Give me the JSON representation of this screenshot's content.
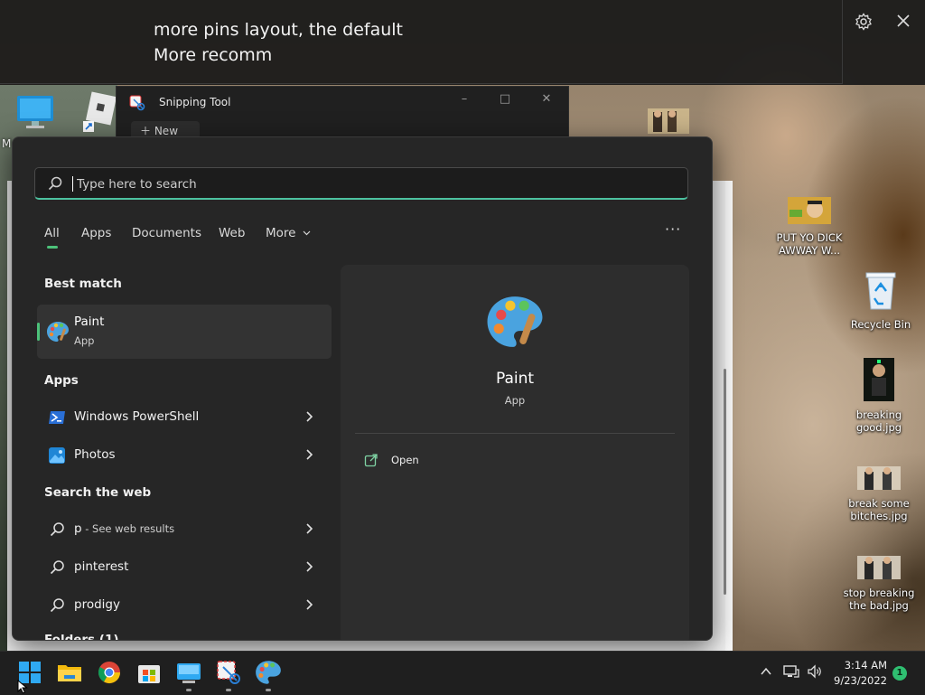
{
  "caption": {
    "line1": "more pins layout, the default",
    "line2": "More recomm",
    "settings_icon": "gear-icon",
    "close_icon": "close-icon"
  },
  "desktop": {
    "left_label_fragment": "M",
    "icons": [
      {
        "label": "PUT YO DICK AWWAY W...",
        "icon": "image-thumbnail"
      },
      {
        "label": "Recycle Bin",
        "icon": "recycle-bin-icon"
      },
      {
        "label": "breaking good.jpg",
        "icon": "image-thumbnail"
      },
      {
        "label": "break some bitches.jpg",
        "icon": "image-thumbnail"
      },
      {
        "label": "stop breaking the bad.jpg",
        "icon": "image-thumbnail"
      }
    ]
  },
  "snipping_tool": {
    "title": "Snipping Tool",
    "new_label": "New"
  },
  "search": {
    "placeholder": "Type here to search",
    "value": ""
  },
  "filters": {
    "tabs": [
      {
        "label": "All",
        "active": true
      },
      {
        "label": "Apps",
        "active": false
      },
      {
        "label": "Documents",
        "active": false
      },
      {
        "label": "Web",
        "active": false
      },
      {
        "label": "More",
        "active": false
      }
    ],
    "more_options": "···"
  },
  "best_match": {
    "section_title": "Best match",
    "name": "Paint",
    "type": "App",
    "icon": "paint-palette-icon"
  },
  "apps": {
    "section_title": "Apps",
    "items": [
      {
        "label": "Windows PowerShell",
        "icon": "powershell-icon"
      },
      {
        "label": "Photos",
        "icon": "photos-icon"
      }
    ]
  },
  "web": {
    "section_title": "Search the web",
    "items": [
      {
        "label": "p",
        "sub": " - See web results"
      },
      {
        "label": "pinterest",
        "sub": ""
      },
      {
        "label": "prodigy",
        "sub": ""
      }
    ]
  },
  "folders": {
    "section_title_fragment": "Folders (1)"
  },
  "detail": {
    "name": "Paint",
    "type": "App",
    "open_label": "Open"
  },
  "taskbar": {
    "apps": [
      "start-icon",
      "file-explorer-icon",
      "chrome-icon",
      "store-icon",
      "remote-desktop-icon",
      "snipping-tool-icon",
      "paint-palette-icon"
    ],
    "clock_time": "3:14 AM",
    "clock_date": "9/23/2022",
    "notification_count": "1"
  },
  "colors": {
    "accent_green": "#4cc27a",
    "panel_bg": "#262626",
    "detail_bg": "#2d2d2d",
    "taskbar_bg": "#1f1f1f"
  }
}
